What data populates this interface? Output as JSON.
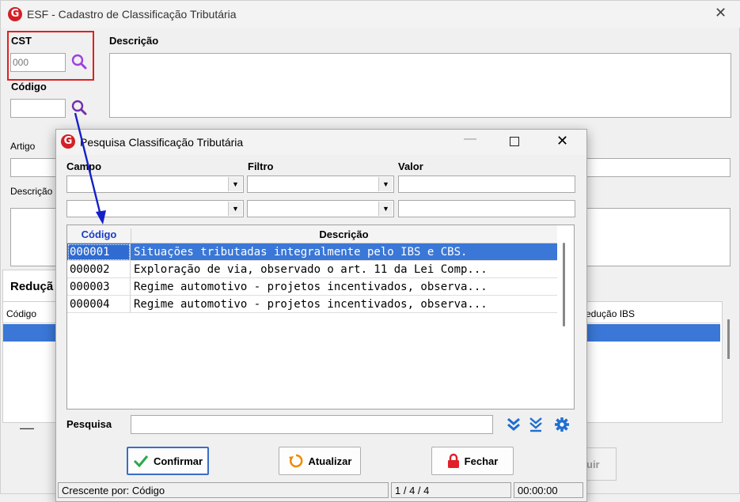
{
  "main_window": {
    "title": "ESF - Cadastro de Classificação Tributária",
    "cst_label": "CST",
    "cst_value": "000",
    "codigo_label": "Código",
    "descricao_label": "Descrição",
    "artigo_label": "Artigo",
    "descricao2_label": "Descrição",
    "reducao_tab": "Reduçã",
    "table_col_codigo": "Código",
    "table_col_reducao_ibs": "edução IBS",
    "bg_button_label": "uir",
    "minus": "—"
  },
  "dialog": {
    "title": "Pesquisa Classificação Tributária",
    "campo_label": "Campo",
    "filtro_label": "Filtro",
    "valor_label": "Valor",
    "grid": {
      "headers": [
        "Código",
        "Descrição"
      ],
      "rows": [
        {
          "codigo": "000001",
          "descricao": "Situações tributadas integralmente pelo IBS e CBS."
        },
        {
          "codigo": "000002",
          "descricao": "Exploração de via, observado o art. 11 da Lei Comp..."
        },
        {
          "codigo": "000003",
          "descricao": "Regime automotivo - projetos incentivados, observa..."
        },
        {
          "codigo": "000004",
          "descricao": "Regime automotivo - projetos incentivados, observa..."
        }
      ]
    },
    "pesquisa_label": "Pesquisa",
    "pesquisa_value": "",
    "buttons": {
      "confirmar": "Confirmar",
      "atualizar": "Atualizar",
      "fechar": "Fechar"
    },
    "status": {
      "order": "Crescente por: Código",
      "count": "1 / 4 / 4",
      "time": "00:00:00"
    }
  },
  "colors": {
    "brand_red": "#d32027",
    "selection": "#3a77d6",
    "header_blue": "#1a3cc8",
    "highlight_box": "#e02020",
    "arrow": "#1420c8",
    "search_icon": "#a040e0",
    "toolbar_icon": "#1f6fd0"
  },
  "icons": [
    "search-icon",
    "close-icon",
    "minimize-icon",
    "maximize-icon",
    "chevron-double-down-icon",
    "chevron-double-down-underline-icon",
    "gear-icon",
    "check-icon",
    "refresh-icon",
    "lock-icon"
  ]
}
